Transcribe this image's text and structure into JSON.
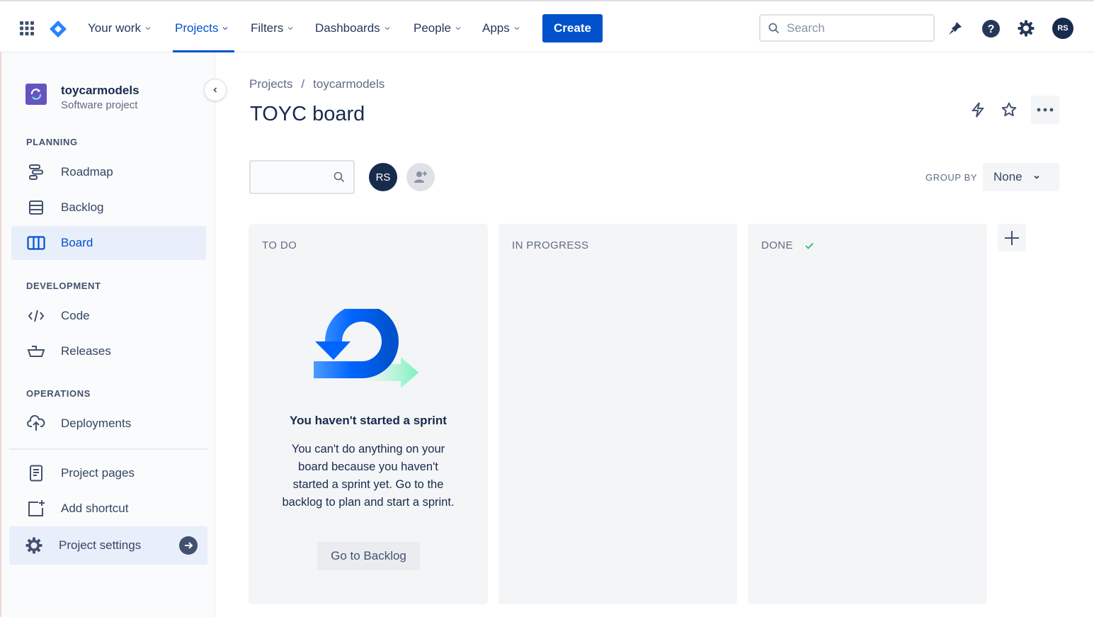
{
  "topnav": {
    "items": [
      {
        "label": "Your work"
      },
      {
        "label": "Projects"
      },
      {
        "label": "Filters"
      },
      {
        "label": "Dashboards"
      },
      {
        "label": "People"
      },
      {
        "label": "Apps"
      }
    ],
    "create_label": "Create",
    "search_placeholder": "Search",
    "avatar_initials": "RS",
    "icons": [
      "app-switcher-icon",
      "jira-logo-icon",
      "notifications-icon",
      "help-icon",
      "settings-icon"
    ]
  },
  "sidebar": {
    "project_name": "toycarmodels",
    "project_type": "Software project",
    "sections": {
      "planning": "PLANNING",
      "development": "DEVELOPMENT",
      "operations": "OPERATIONS"
    },
    "items": {
      "roadmap": "Roadmap",
      "backlog": "Backlog",
      "board": "Board",
      "code": "Code",
      "releases": "Releases",
      "deployments": "Deployments",
      "project_pages": "Project pages",
      "add_shortcut": "Add shortcut",
      "project_settings": "Project settings"
    }
  },
  "main": {
    "breadcrumb": [
      "Projects",
      "/",
      "toycarmodels"
    ],
    "title": "TOYC board",
    "board_avatar": "RS",
    "group_by_label": "GROUP BY",
    "group_by_value": "None",
    "columns": [
      {
        "title": "TO DO"
      },
      {
        "title": "IN PROGRESS"
      },
      {
        "title": "DONE"
      }
    ],
    "empty_state": {
      "title": "You haven't started a sprint",
      "body": "You can't do anything on your board because you haven't started a sprint yet. Go to the backlog to plan and start a sprint.",
      "button": "Go to Backlog"
    }
  },
  "colors": {
    "primary": "#0052cc",
    "text": "#172b4d",
    "subtle_text": "#5e6c84",
    "column_bg": "#f4f5f7",
    "done_check": "#36b37e"
  }
}
